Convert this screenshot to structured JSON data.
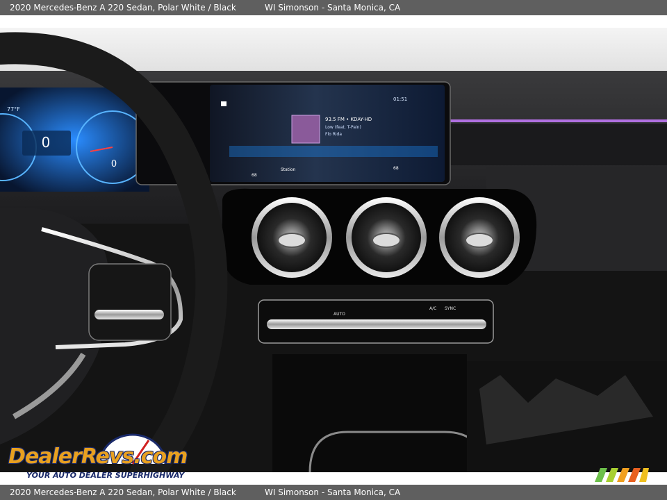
{
  "caption": {
    "title": "2020 Mercedes-Benz A 220 Sedan,  Polar White / Black",
    "dealer": "WI Simonson - Santa Monica, CA"
  },
  "screen": {
    "clock": "01:51",
    "station": "93.5 FM • KDAY-HD",
    "song": "Low (feat. T-Pain)",
    "artist": "Flo Rida",
    "source_label": "Station",
    "temp_left": "68",
    "temp_right": "68"
  },
  "cluster": {
    "outside_temp": "77°F",
    "speed": "0",
    "trip": "0"
  },
  "climate": {
    "auto_label": "AUTO",
    "ac_label": "A/C",
    "sync_label": "SYNC"
  },
  "watermark": {
    "logo": "DealerRevs.com",
    "tagline": "YOUR AUTO DEALER SUPERHIGHWAY"
  },
  "colors": {
    "caption_bar": "#5f5f5f",
    "ambient_light": "#b070e0",
    "screen_glow": "#1e90ff",
    "logo_orange": "#e8a020",
    "logo_navy": "#1a2a6a"
  }
}
